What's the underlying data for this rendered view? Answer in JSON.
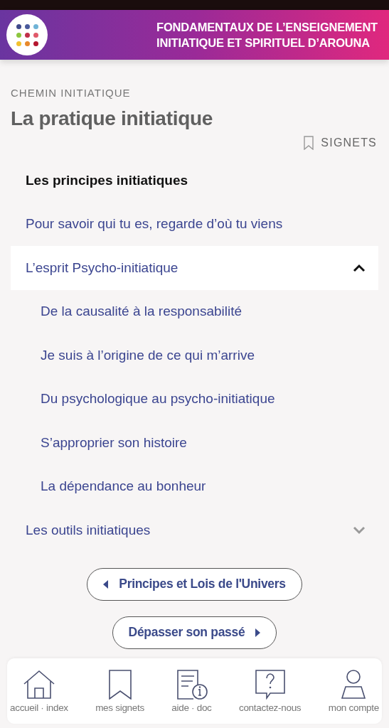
{
  "header": {
    "title_lines": [
      "FONDAMENTAUX DE L’ENSEIGNEMENT",
      "INITIATIQUE ET SPIRITUEL D’AROUNA"
    ],
    "logo_dots": [
      {
        "color": "#3f4a8a"
      },
      {
        "color": "#4a5a9c"
      },
      {
        "color": "#6fb3d6"
      },
      {
        "color": "#8cc63f"
      },
      {
        "color": "#c0304a"
      },
      {
        "color": "#e05a6a"
      },
      {
        "color": "#f2c12e"
      },
      {
        "color": "#e8892b"
      },
      {
        "color": "#b5172f"
      }
    ]
  },
  "breadcrumb": "CHEMIN INITIATIQUE",
  "page_title": "La pratique initiatique",
  "bookmarks_link": "SIGNETS",
  "nav": [
    {
      "kind": "heading",
      "label": "Les principes initiatiques"
    },
    {
      "kind": "link",
      "label": "Pour savoir qui tu es, regarde d’où tu viens"
    },
    {
      "kind": "group",
      "label": "L’esprit Psycho-initiatique",
      "expanded": true,
      "children": [
        {
          "label": "De la causalité à la responsabilité"
        },
        {
          "label": "Je suis à l’origine de ce qui m’arrive"
        },
        {
          "label": "Du psychologique au psycho-initiatique"
        },
        {
          "label": "S’approprier son histoire"
        },
        {
          "label": "La dépendance au bonheur"
        }
      ]
    },
    {
      "kind": "group",
      "label": "Les outils initiatiques",
      "expanded": false
    }
  ],
  "pager": [
    {
      "kind": "previous",
      "label": "Principes et Lois de l'Univers"
    },
    {
      "kind": "next",
      "label": "Dépasser son passé"
    }
  ],
  "tab_bar": [
    {
      "kind": "home",
      "label": "accueil · index"
    },
    {
      "kind": "bookmark",
      "label": "mes signets"
    },
    {
      "kind": "help",
      "label": "aide · doc"
    },
    {
      "kind": "contact",
      "label": "contactez-nous"
    },
    {
      "kind": "account",
      "label": "mon compte"
    }
  ]
}
